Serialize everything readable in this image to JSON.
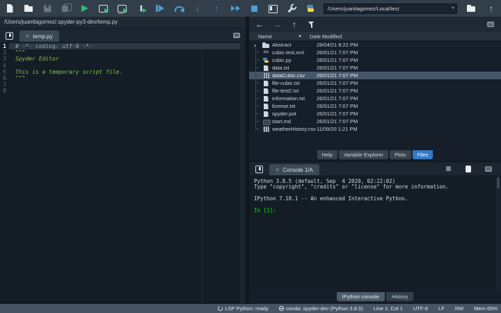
{
  "colors": {
    "run_green": "#2dbe6c",
    "debug_blue": "#4d9fd6",
    "prompt_green": "#00b300",
    "selected_tab_blue": "#3279c9",
    "selection_bg": "#45566a",
    "statusbar_bg": "#465463"
  },
  "toolbar": {
    "working_directory": "/Users/juanitagomez/Local/test",
    "dropdown_glyph": "▼",
    "icons": [
      {
        "name": "new-file-icon",
        "kind": "i-doc"
      },
      {
        "name": "open-file-icon",
        "kind": "i-folder"
      },
      {
        "name": "save-icon",
        "kind": "i-floppy",
        "disabled": true
      },
      {
        "name": "save-all-icon",
        "kind": "i-floppyall",
        "disabled": true
      },
      {
        "name": "run-icon",
        "kind": "i-play"
      },
      {
        "name": "run-cell-icon",
        "kind": "i-runcell"
      },
      {
        "name": "run-cell-advance-icon",
        "kind": "i-runcelladv"
      },
      {
        "name": "run-selection-icon",
        "kind": "i-runsel",
        "glyph": "I"
      },
      {
        "name": "debug-icon",
        "kind": "i-debug"
      },
      {
        "name": "step-over-icon",
        "kind": "i-stepover"
      },
      {
        "name": "step-into-icon",
        "kind": "i-glyphblue",
        "glyph": "↓"
      },
      {
        "name": "step-out-icon",
        "kind": "i-glyphblue",
        "glyph": "↑"
      },
      {
        "name": "continue-icon",
        "kind": "i-cont"
      },
      {
        "name": "stop-icon",
        "kind": "i-stop"
      },
      {
        "name": "maximize-pane-icon",
        "kind": "i-max"
      },
      {
        "name": "preferences-icon",
        "kind": "i-wrench"
      },
      {
        "name": "python-env-icon",
        "kind": "i-py"
      }
    ],
    "right_icons": [
      {
        "name": "browse-working-directory-icon",
        "kind": "i-folder"
      },
      {
        "name": "parent-directory-icon",
        "kind": "i-glyphwhite",
        "glyph": "↑"
      }
    ]
  },
  "editor": {
    "breadcrumb": "/Users/juanitagomez/.spyder-py3-dev/temp.py",
    "tab": "temp.py",
    "close_glyph": "×",
    "lines": [
      {
        "n": 1,
        "text": "# -*- coding: utf-8 -*-",
        "token": "comment",
        "current": true
      },
      {
        "n": 2,
        "text": "\"\"\"",
        "token": "string"
      },
      {
        "n": 3,
        "text": "Spyder Editor",
        "token": "string"
      },
      {
        "n": 4,
        "text": "",
        "token": ""
      },
      {
        "n": 5,
        "text": "This is a temporary script file.",
        "token": "string"
      },
      {
        "n": 6,
        "text": "\"\"\"",
        "token": "string"
      },
      {
        "n": 7,
        "text": "",
        "token": ""
      },
      {
        "n": 8,
        "text": "",
        "token": ""
      }
    ]
  },
  "files_pane": {
    "toolbar_icons": [
      {
        "name": "back-icon",
        "kind": "i-glyphwhite",
        "glyph": "←"
      },
      {
        "name": "forward-icon",
        "kind": "i-glyphdim",
        "glyph": "→"
      },
      {
        "name": "parent-folder-icon",
        "kind": "i-glyphwhite",
        "glyph": "↑"
      },
      {
        "name": "filter-icon",
        "kind": "i-funnel"
      }
    ],
    "columns": [
      "Name",
      "Date Modified"
    ],
    "sort_glyph": "▲",
    "expander_glyph": "›",
    "rows": [
      {
        "name": "Abstract",
        "date": "28/04/21 8:22 PM",
        "icon": "folder",
        "expandable": true
      },
      {
        "name": "cubic-test.xml",
        "date": "26/01/21 7:07 PM",
        "icon": "xml"
      },
      {
        "name": "cubic.py",
        "date": "26/01/21 7:07 PM",
        "icon": "python"
      },
      {
        "name": "data.txt",
        "date": "26/01/21 7:07 PM",
        "icon": "text"
      },
      {
        "name": "dataCubic.csv",
        "date": "26/01/21 7:07 PM",
        "icon": "csv",
        "selected": true
      },
      {
        "name": "file-cubic.txt",
        "date": "26/01/21 7:07 PM",
        "icon": "text"
      },
      {
        "name": "file-test2.txt",
        "date": "26/01/21 7:07 PM",
        "icon": "text"
      },
      {
        "name": "information.txt",
        "date": "26/01/21 7:07 PM",
        "icon": "text"
      },
      {
        "name": "license.txt",
        "date": "26/01/21 7:07 PM",
        "icon": "text"
      },
      {
        "name": "spyder.pot",
        "date": "26/01/21 7:07 PM",
        "icon": "text"
      },
      {
        "name": "start.md",
        "date": "26/01/21 7:07 PM",
        "icon": "markdown"
      },
      {
        "name": "weatherHistory.csv",
        "date": "11/09/20 1:21 PM",
        "icon": "csv"
      }
    ],
    "tabs": [
      "Help",
      "Variable Explorer",
      "Plots",
      "Files"
    ],
    "selected_tab": "Files"
  },
  "console": {
    "tab": "Console 1/A",
    "close_glyph": "×",
    "banner": [
      "Python 3.8.5 (default, Sep  4 2020, 02:22:02) ",
      "Type \"copyright\", \"credits\" or \"license\" for more information.",
      "",
      "IPython 7.18.1 -- An enhanced Interactive Python.",
      ""
    ],
    "prompt": "In [1]:",
    "tabs": [
      "IPython console",
      "History"
    ],
    "selected_tab": "IPython console"
  },
  "statusbar": {
    "lsp": "LSP Python: ready",
    "environment": "conda: spyder-dev (Python 3.8.5)",
    "cursor": "Line 1, Col 1",
    "encoding": "UTF-8",
    "eol": "LF",
    "permissions": "RW",
    "memory": "Mem 65%"
  }
}
